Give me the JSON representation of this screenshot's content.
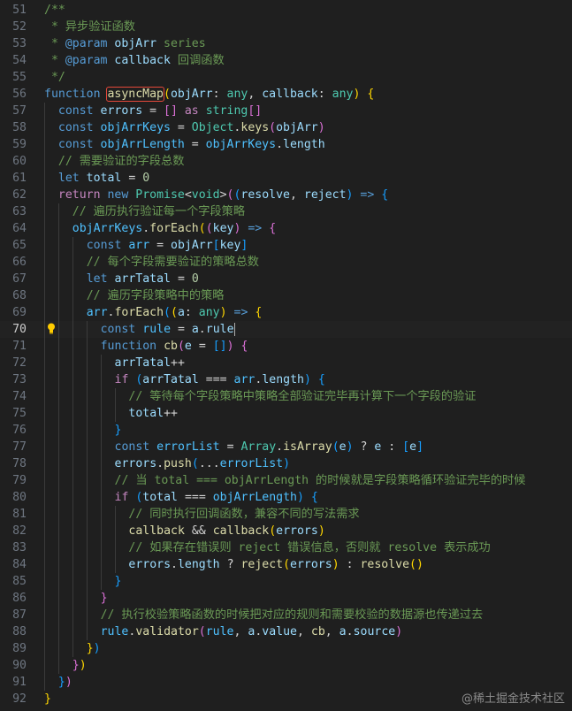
{
  "editor": {
    "current_line": 70,
    "highlight_word": "asyncMap",
    "watermark": "@稀土掘金技术社区",
    "colors": {
      "background": "#1f1f1f",
      "keyword": "#569cd6",
      "control": "#c586c0",
      "function": "#dcdcaa",
      "variable": "#9cdcfe",
      "constant": "#4fc1ff",
      "type": "#4ec9b0",
      "number": "#b5cea8",
      "comment": "#6a9955",
      "highlight_box": "#e5483a"
    },
    "lines": [
      {
        "n": 51,
        "indent": 0,
        "tokens": [
          [
            "/**",
            "com"
          ]
        ]
      },
      {
        "n": 52,
        "indent": 0,
        "tokens": [
          [
            " * 异步验证函数",
            "com"
          ]
        ]
      },
      {
        "n": 53,
        "indent": 0,
        "tokens": [
          [
            " * ",
            "com"
          ],
          [
            "@param",
            "kw"
          ],
          [
            " ",
            "com"
          ],
          [
            "objArr",
            "var"
          ],
          [
            " series",
            "com"
          ]
        ]
      },
      {
        "n": 54,
        "indent": 0,
        "tokens": [
          [
            " * ",
            "com"
          ],
          [
            "@param",
            "kw"
          ],
          [
            " ",
            "com"
          ],
          [
            "callback",
            "var"
          ],
          [
            " 回调函数",
            "com"
          ]
        ]
      },
      {
        "n": 55,
        "indent": 0,
        "tokens": [
          [
            " */",
            "com"
          ]
        ]
      },
      {
        "n": 56,
        "indent": 0,
        "tokens": [
          [
            "function",
            "kw"
          ],
          [
            " ",
            "pun"
          ],
          [
            "asyncMap",
            "fn",
            "box"
          ],
          [
            "(",
            "b1"
          ],
          [
            "objArr",
            "var"
          ],
          [
            ": ",
            "pun"
          ],
          [
            "any",
            "type"
          ],
          [
            ", ",
            "pun"
          ],
          [
            "callback",
            "var"
          ],
          [
            ": ",
            "pun"
          ],
          [
            "any",
            "type"
          ],
          [
            ")",
            "b1"
          ],
          [
            " ",
            "pun"
          ],
          [
            "{",
            "b1"
          ]
        ]
      },
      {
        "n": 57,
        "indent": 1,
        "tokens": [
          [
            "const",
            "kw"
          ],
          [
            " ",
            "pun"
          ],
          [
            "errors",
            "var"
          ],
          [
            " = ",
            "pun"
          ],
          [
            "[]",
            "b2"
          ],
          [
            " ",
            "pun"
          ],
          [
            "as",
            "ctl"
          ],
          [
            " ",
            "pun"
          ],
          [
            "string",
            "type"
          ],
          [
            "[]",
            "b2"
          ]
        ]
      },
      {
        "n": 58,
        "indent": 1,
        "tokens": [
          [
            "const",
            "kw"
          ],
          [
            " ",
            "pun"
          ],
          [
            "objArrKeys",
            "cnst"
          ],
          [
            " = ",
            "pun"
          ],
          [
            "Object",
            "type"
          ],
          [
            ".",
            "pun"
          ],
          [
            "keys",
            "fn"
          ],
          [
            "(",
            "b2"
          ],
          [
            "objArr",
            "var"
          ],
          [
            ")",
            "b2"
          ]
        ]
      },
      {
        "n": 59,
        "indent": 1,
        "tokens": [
          [
            "const",
            "kw"
          ],
          [
            " ",
            "pun"
          ],
          [
            "objArrLength",
            "cnst"
          ],
          [
            " = ",
            "pun"
          ],
          [
            "objArrKeys",
            "cnst"
          ],
          [
            ".",
            "pun"
          ],
          [
            "length",
            "var"
          ]
        ]
      },
      {
        "n": 60,
        "indent": 1,
        "tokens": [
          [
            "// 需要验证的字段总数",
            "com"
          ]
        ]
      },
      {
        "n": 61,
        "indent": 1,
        "tokens": [
          [
            "let",
            "kw"
          ],
          [
            " ",
            "pun"
          ],
          [
            "total",
            "var"
          ],
          [
            " = ",
            "pun"
          ],
          [
            "0",
            "num"
          ]
        ]
      },
      {
        "n": 62,
        "indent": 1,
        "tokens": [
          [
            "return",
            "ctl"
          ],
          [
            " ",
            "pun"
          ],
          [
            "new",
            "kw"
          ],
          [
            " ",
            "pun"
          ],
          [
            "Promise",
            "type"
          ],
          [
            "<",
            "pun"
          ],
          [
            "void",
            "type"
          ],
          [
            ">",
            "pun"
          ],
          [
            "(",
            "b2"
          ],
          [
            "(",
            "b3"
          ],
          [
            "resolve",
            "var"
          ],
          [
            ", ",
            "pun"
          ],
          [
            "reject",
            "var"
          ],
          [
            ")",
            "b3"
          ],
          [
            " => ",
            "kw"
          ],
          [
            "{",
            "b3"
          ]
        ]
      },
      {
        "n": 63,
        "indent": 2,
        "tokens": [
          [
            "// 遍历执行验证每一个字段策略",
            "com"
          ]
        ]
      },
      {
        "n": 64,
        "indent": 2,
        "tokens": [
          [
            "objArrKeys",
            "cnst"
          ],
          [
            ".",
            "pun"
          ],
          [
            "forEach",
            "fn"
          ],
          [
            "(",
            "b1"
          ],
          [
            "(",
            "b2"
          ],
          [
            "key",
            "var"
          ],
          [
            ")",
            "b2"
          ],
          [
            " => ",
            "kw"
          ],
          [
            "{",
            "b2"
          ]
        ]
      },
      {
        "n": 65,
        "indent": 3,
        "tokens": [
          [
            "const",
            "kw"
          ],
          [
            " ",
            "pun"
          ],
          [
            "arr",
            "cnst"
          ],
          [
            " = ",
            "pun"
          ],
          [
            "objArr",
            "var"
          ],
          [
            "[",
            "b3"
          ],
          [
            "key",
            "var"
          ],
          [
            "]",
            "b3"
          ]
        ]
      },
      {
        "n": 66,
        "indent": 3,
        "tokens": [
          [
            "// 每个字段需要验证的策略总数",
            "com"
          ]
        ]
      },
      {
        "n": 67,
        "indent": 3,
        "tokens": [
          [
            "let",
            "kw"
          ],
          [
            " ",
            "pun"
          ],
          [
            "arrTatal",
            "var"
          ],
          [
            " = ",
            "pun"
          ],
          [
            "0",
            "num"
          ]
        ]
      },
      {
        "n": 68,
        "indent": 3,
        "tokens": [
          [
            "// 遍历字段策略中的策略",
            "com"
          ]
        ]
      },
      {
        "n": 69,
        "indent": 3,
        "tokens": [
          [
            "arr",
            "cnst"
          ],
          [
            ".",
            "pun"
          ],
          [
            "forEach",
            "fn"
          ],
          [
            "(",
            "b3"
          ],
          [
            "(",
            "b1"
          ],
          [
            "a",
            "var"
          ],
          [
            ": ",
            "pun"
          ],
          [
            "any",
            "type"
          ],
          [
            ")",
            "b1"
          ],
          [
            " => ",
            "kw"
          ],
          [
            "{",
            "b1"
          ]
        ]
      },
      {
        "n": 70,
        "indent": 4,
        "tokens": [
          [
            "const",
            "kw"
          ],
          [
            " ",
            "pun"
          ],
          [
            "rule",
            "cnst"
          ],
          [
            " = ",
            "pun"
          ],
          [
            "a",
            "var"
          ],
          [
            ".",
            "pun"
          ],
          [
            "rule",
            "var"
          ]
        ]
      },
      {
        "n": 71,
        "indent": 4,
        "tokens": [
          [
            "function",
            "kw"
          ],
          [
            " ",
            "pun"
          ],
          [
            "cb",
            "fn"
          ],
          [
            "(",
            "b2"
          ],
          [
            "e",
            "var"
          ],
          [
            " = ",
            "pun"
          ],
          [
            "[]",
            "b3"
          ],
          [
            ")",
            "b2"
          ],
          [
            " ",
            "pun"
          ],
          [
            "{",
            "b2"
          ]
        ]
      },
      {
        "n": 72,
        "indent": 5,
        "tokens": [
          [
            "arrTatal",
            "var"
          ],
          [
            "++",
            "pun"
          ]
        ]
      },
      {
        "n": 73,
        "indent": 5,
        "tokens": [
          [
            "if",
            "ctl"
          ],
          [
            " ",
            "pun"
          ],
          [
            "(",
            "b3"
          ],
          [
            "arrTatal",
            "var"
          ],
          [
            " === ",
            "pun"
          ],
          [
            "arr",
            "cnst"
          ],
          [
            ".",
            "pun"
          ],
          [
            "length",
            "var"
          ],
          [
            ")",
            "b3"
          ],
          [
            " ",
            "pun"
          ],
          [
            "{",
            "b3"
          ]
        ]
      },
      {
        "n": 74,
        "indent": 6,
        "tokens": [
          [
            "// 等待每个字段策略中策略全部验证完毕再计算下一个字段的验证",
            "com"
          ]
        ]
      },
      {
        "n": 75,
        "indent": 6,
        "tokens": [
          [
            "total",
            "var"
          ],
          [
            "++",
            "pun"
          ]
        ]
      },
      {
        "n": 76,
        "indent": 5,
        "tokens": [
          [
            "}",
            "b3"
          ]
        ]
      },
      {
        "n": 77,
        "indent": 5,
        "tokens": [
          [
            "const",
            "kw"
          ],
          [
            " ",
            "pun"
          ],
          [
            "errorList",
            "cnst"
          ],
          [
            " = ",
            "pun"
          ],
          [
            "Array",
            "type"
          ],
          [
            ".",
            "pun"
          ],
          [
            "isArray",
            "fn"
          ],
          [
            "(",
            "b3"
          ],
          [
            "e",
            "var"
          ],
          [
            ")",
            "b3"
          ],
          [
            " ? ",
            "pun"
          ],
          [
            "e",
            "var"
          ],
          [
            " : ",
            "pun"
          ],
          [
            "[",
            "b3"
          ],
          [
            "e",
            "var"
          ],
          [
            "]",
            "b3"
          ]
        ]
      },
      {
        "n": 78,
        "indent": 5,
        "tokens": [
          [
            "errors",
            "var"
          ],
          [
            ".",
            "pun"
          ],
          [
            "push",
            "fn"
          ],
          [
            "(",
            "b3"
          ],
          [
            "...",
            "pun"
          ],
          [
            "errorList",
            "cnst"
          ],
          [
            ")",
            "b3"
          ]
        ]
      },
      {
        "n": 79,
        "indent": 5,
        "tokens": [
          [
            "// 当 total === objArrLength 的时候就是字段策略循环验证完毕的时候",
            "com"
          ]
        ]
      },
      {
        "n": 80,
        "indent": 5,
        "tokens": [
          [
            "if",
            "ctl"
          ],
          [
            " ",
            "pun"
          ],
          [
            "(",
            "b3"
          ],
          [
            "total",
            "var"
          ],
          [
            " === ",
            "pun"
          ],
          [
            "objArrLength",
            "cnst"
          ],
          [
            ")",
            "b3"
          ],
          [
            " ",
            "pun"
          ],
          [
            "{",
            "b3"
          ]
        ]
      },
      {
        "n": 81,
        "indent": 6,
        "tokens": [
          [
            "// 同时执行回调函数，兼容不同的写法需求",
            "com"
          ]
        ]
      },
      {
        "n": 82,
        "indent": 6,
        "tokens": [
          [
            "callback",
            "fn"
          ],
          [
            " && ",
            "pun"
          ],
          [
            "callback",
            "fn"
          ],
          [
            "(",
            "b1"
          ],
          [
            "errors",
            "var"
          ],
          [
            ")",
            "b1"
          ]
        ]
      },
      {
        "n": 83,
        "indent": 6,
        "tokens": [
          [
            "// 如果存在错误则 reject 错误信息，否则就 resolve 表示成功",
            "com"
          ]
        ]
      },
      {
        "n": 84,
        "indent": 6,
        "tokens": [
          [
            "errors",
            "var"
          ],
          [
            ".",
            "pun"
          ],
          [
            "length",
            "var"
          ],
          [
            " ? ",
            "pun"
          ],
          [
            "reject",
            "fn"
          ],
          [
            "(",
            "b1"
          ],
          [
            "errors",
            "var"
          ],
          [
            ")",
            "b1"
          ],
          [
            " : ",
            "pun"
          ],
          [
            "resolve",
            "fn"
          ],
          [
            "()",
            "b1"
          ]
        ]
      },
      {
        "n": 85,
        "indent": 5,
        "tokens": [
          [
            "}",
            "b3"
          ]
        ]
      },
      {
        "n": 86,
        "indent": 4,
        "tokens": [
          [
            "}",
            "b2"
          ]
        ]
      },
      {
        "n": 87,
        "indent": 4,
        "tokens": [
          [
            "// 执行校验策略函数的时候把对应的规则和需要校验的数据源也传递过去",
            "com"
          ]
        ]
      },
      {
        "n": 88,
        "indent": 4,
        "tokens": [
          [
            "rule",
            "cnst"
          ],
          [
            ".",
            "pun"
          ],
          [
            "validator",
            "fn"
          ],
          [
            "(",
            "b2"
          ],
          [
            "rule",
            "cnst"
          ],
          [
            ", ",
            "pun"
          ],
          [
            "a",
            "var"
          ],
          [
            ".",
            "pun"
          ],
          [
            "value",
            "var"
          ],
          [
            ", ",
            "pun"
          ],
          [
            "cb",
            "fn"
          ],
          [
            ", ",
            "pun"
          ],
          [
            "a",
            "var"
          ],
          [
            ".",
            "pun"
          ],
          [
            "source",
            "var"
          ],
          [
            ")",
            "b2"
          ]
        ]
      },
      {
        "n": 89,
        "indent": 3,
        "tokens": [
          [
            "}",
            "b1"
          ],
          [
            ")",
            "b3"
          ]
        ]
      },
      {
        "n": 90,
        "indent": 2,
        "tokens": [
          [
            "}",
            "b2"
          ],
          [
            ")",
            "b1"
          ]
        ]
      },
      {
        "n": 91,
        "indent": 1,
        "tokens": [
          [
            "}",
            "b3"
          ],
          [
            ")",
            "b2"
          ]
        ]
      },
      {
        "n": 92,
        "indent": 0,
        "tokens": [
          [
            "}",
            "b1"
          ]
        ]
      }
    ]
  }
}
